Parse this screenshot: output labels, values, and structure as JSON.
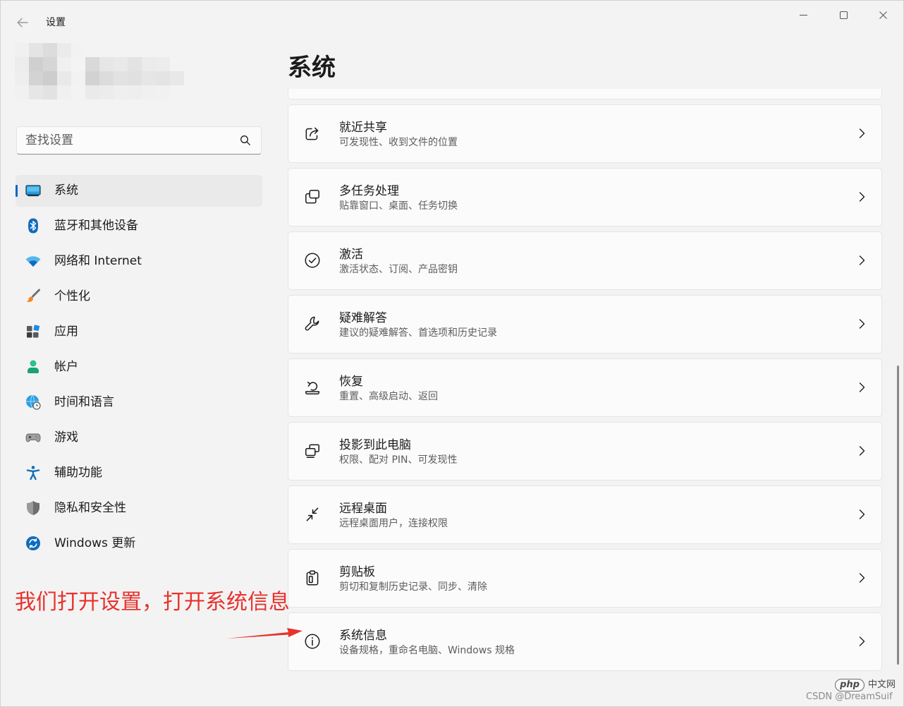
{
  "window": {
    "title": "设置",
    "back_icon": "back-arrow-icon",
    "controls": [
      "minimize-icon",
      "maximize-icon",
      "close-icon"
    ]
  },
  "search": {
    "placeholder": "查找设置",
    "icon": "search-icon"
  },
  "sidebar": {
    "items": [
      {
        "label": "系统",
        "icon": "system-icon",
        "selected": true
      },
      {
        "label": "蓝牙和其他设备",
        "icon": "bluetooth-icon",
        "selected": false
      },
      {
        "label": "网络和 Internet",
        "icon": "wifi-icon",
        "selected": false
      },
      {
        "label": "个性化",
        "icon": "paintbrush-icon",
        "selected": false
      },
      {
        "label": "应用",
        "icon": "apps-icon",
        "selected": false
      },
      {
        "label": "帐户",
        "icon": "account-icon",
        "selected": false
      },
      {
        "label": "时间和语言",
        "icon": "time-language-icon",
        "selected": false
      },
      {
        "label": "游戏",
        "icon": "gamepad-icon",
        "selected": false
      },
      {
        "label": "辅助功能",
        "icon": "accessibility-icon",
        "selected": false
      },
      {
        "label": "隐私和安全性",
        "icon": "shield-icon",
        "selected": false
      },
      {
        "label": "Windows 更新",
        "icon": "windows-update-icon",
        "selected": false
      }
    ]
  },
  "main": {
    "title": "系统",
    "cards": [
      {
        "title": "就近共享",
        "subtitle": "可发现性、收到文件的位置",
        "icon": "share-icon"
      },
      {
        "title": "多任务处理",
        "subtitle": "贴靠窗口、桌面、任务切换",
        "icon": "multitasking-icon"
      },
      {
        "title": "激活",
        "subtitle": "激活状态、订阅、产品密钥",
        "icon": "activation-check-icon"
      },
      {
        "title": "疑难解答",
        "subtitle": "建议的疑难解答、首选项和历史记录",
        "icon": "wrench-icon"
      },
      {
        "title": "恢复",
        "subtitle": "重置、高级启动、返回",
        "icon": "recovery-icon"
      },
      {
        "title": "投影到此电脑",
        "subtitle": "权限、配对 PIN、可发现性",
        "icon": "projection-icon"
      },
      {
        "title": "远程桌面",
        "subtitle": "远程桌面用户，连接权限",
        "icon": "remote-desktop-icon"
      },
      {
        "title": "剪贴板",
        "subtitle": "剪切和复制历史记录、同步、清除",
        "icon": "clipboard-icon"
      },
      {
        "title": "系统信息",
        "subtitle": "设备规格，重命名电脑、Windows 规格",
        "icon": "info-icon"
      }
    ],
    "chevron_icon": "chevron-right-icon"
  },
  "annotation": {
    "text": "我们打开设置，打开系统信息",
    "color": "#e8322c"
  },
  "watermark": {
    "logo_text": "php",
    "logo_suffix": "中文网",
    "credit": "CSDN @DreamSuif"
  },
  "colors": {
    "background": "#f3f3f3",
    "card": "#fbfbfb",
    "accent": "#0067c0",
    "text": "#1b1b1b",
    "secondary_text": "#5d5d5d"
  }
}
